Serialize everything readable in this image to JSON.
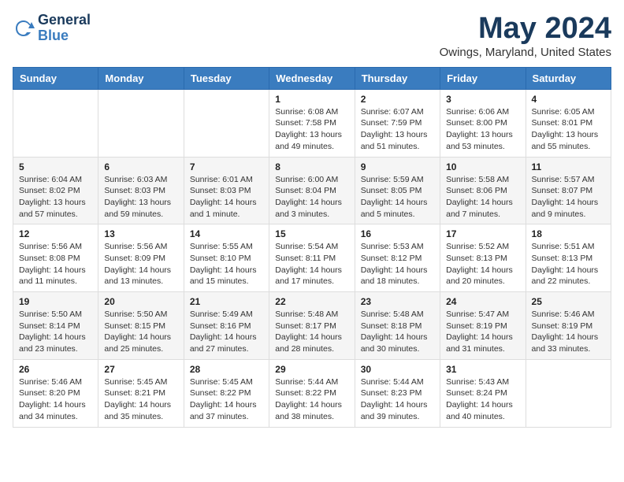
{
  "header": {
    "logo_general": "General",
    "logo_blue": "Blue",
    "month_title": "May 2024",
    "location": "Owings, Maryland, United States"
  },
  "weekdays": [
    "Sunday",
    "Monday",
    "Tuesday",
    "Wednesday",
    "Thursday",
    "Friday",
    "Saturday"
  ],
  "weeks": [
    [
      {
        "day": "",
        "sunrise": "",
        "sunset": "",
        "daylight": ""
      },
      {
        "day": "",
        "sunrise": "",
        "sunset": "",
        "daylight": ""
      },
      {
        "day": "",
        "sunrise": "",
        "sunset": "",
        "daylight": ""
      },
      {
        "day": "1",
        "sunrise": "Sunrise: 6:08 AM",
        "sunset": "Sunset: 7:58 PM",
        "daylight": "Daylight: 13 hours and 49 minutes."
      },
      {
        "day": "2",
        "sunrise": "Sunrise: 6:07 AM",
        "sunset": "Sunset: 7:59 PM",
        "daylight": "Daylight: 13 hours and 51 minutes."
      },
      {
        "day": "3",
        "sunrise": "Sunrise: 6:06 AM",
        "sunset": "Sunset: 8:00 PM",
        "daylight": "Daylight: 13 hours and 53 minutes."
      },
      {
        "day": "4",
        "sunrise": "Sunrise: 6:05 AM",
        "sunset": "Sunset: 8:01 PM",
        "daylight": "Daylight: 13 hours and 55 minutes."
      }
    ],
    [
      {
        "day": "5",
        "sunrise": "Sunrise: 6:04 AM",
        "sunset": "Sunset: 8:02 PM",
        "daylight": "Daylight: 13 hours and 57 minutes."
      },
      {
        "day": "6",
        "sunrise": "Sunrise: 6:03 AM",
        "sunset": "Sunset: 8:03 PM",
        "daylight": "Daylight: 13 hours and 59 minutes."
      },
      {
        "day": "7",
        "sunrise": "Sunrise: 6:01 AM",
        "sunset": "Sunset: 8:03 PM",
        "daylight": "Daylight: 14 hours and 1 minute."
      },
      {
        "day": "8",
        "sunrise": "Sunrise: 6:00 AM",
        "sunset": "Sunset: 8:04 PM",
        "daylight": "Daylight: 14 hours and 3 minutes."
      },
      {
        "day": "9",
        "sunrise": "Sunrise: 5:59 AM",
        "sunset": "Sunset: 8:05 PM",
        "daylight": "Daylight: 14 hours and 5 minutes."
      },
      {
        "day": "10",
        "sunrise": "Sunrise: 5:58 AM",
        "sunset": "Sunset: 8:06 PM",
        "daylight": "Daylight: 14 hours and 7 minutes."
      },
      {
        "day": "11",
        "sunrise": "Sunrise: 5:57 AM",
        "sunset": "Sunset: 8:07 PM",
        "daylight": "Daylight: 14 hours and 9 minutes."
      }
    ],
    [
      {
        "day": "12",
        "sunrise": "Sunrise: 5:56 AM",
        "sunset": "Sunset: 8:08 PM",
        "daylight": "Daylight: 14 hours and 11 minutes."
      },
      {
        "day": "13",
        "sunrise": "Sunrise: 5:56 AM",
        "sunset": "Sunset: 8:09 PM",
        "daylight": "Daylight: 14 hours and 13 minutes."
      },
      {
        "day": "14",
        "sunrise": "Sunrise: 5:55 AM",
        "sunset": "Sunset: 8:10 PM",
        "daylight": "Daylight: 14 hours and 15 minutes."
      },
      {
        "day": "15",
        "sunrise": "Sunrise: 5:54 AM",
        "sunset": "Sunset: 8:11 PM",
        "daylight": "Daylight: 14 hours and 17 minutes."
      },
      {
        "day": "16",
        "sunrise": "Sunrise: 5:53 AM",
        "sunset": "Sunset: 8:12 PM",
        "daylight": "Daylight: 14 hours and 18 minutes."
      },
      {
        "day": "17",
        "sunrise": "Sunrise: 5:52 AM",
        "sunset": "Sunset: 8:13 PM",
        "daylight": "Daylight: 14 hours and 20 minutes."
      },
      {
        "day": "18",
        "sunrise": "Sunrise: 5:51 AM",
        "sunset": "Sunset: 8:13 PM",
        "daylight": "Daylight: 14 hours and 22 minutes."
      }
    ],
    [
      {
        "day": "19",
        "sunrise": "Sunrise: 5:50 AM",
        "sunset": "Sunset: 8:14 PM",
        "daylight": "Daylight: 14 hours and 23 minutes."
      },
      {
        "day": "20",
        "sunrise": "Sunrise: 5:50 AM",
        "sunset": "Sunset: 8:15 PM",
        "daylight": "Daylight: 14 hours and 25 minutes."
      },
      {
        "day": "21",
        "sunrise": "Sunrise: 5:49 AM",
        "sunset": "Sunset: 8:16 PM",
        "daylight": "Daylight: 14 hours and 27 minutes."
      },
      {
        "day": "22",
        "sunrise": "Sunrise: 5:48 AM",
        "sunset": "Sunset: 8:17 PM",
        "daylight": "Daylight: 14 hours and 28 minutes."
      },
      {
        "day": "23",
        "sunrise": "Sunrise: 5:48 AM",
        "sunset": "Sunset: 8:18 PM",
        "daylight": "Daylight: 14 hours and 30 minutes."
      },
      {
        "day": "24",
        "sunrise": "Sunrise: 5:47 AM",
        "sunset": "Sunset: 8:19 PM",
        "daylight": "Daylight: 14 hours and 31 minutes."
      },
      {
        "day": "25",
        "sunrise": "Sunrise: 5:46 AM",
        "sunset": "Sunset: 8:19 PM",
        "daylight": "Daylight: 14 hours and 33 minutes."
      }
    ],
    [
      {
        "day": "26",
        "sunrise": "Sunrise: 5:46 AM",
        "sunset": "Sunset: 8:20 PM",
        "daylight": "Daylight: 14 hours and 34 minutes."
      },
      {
        "day": "27",
        "sunrise": "Sunrise: 5:45 AM",
        "sunset": "Sunset: 8:21 PM",
        "daylight": "Daylight: 14 hours and 35 minutes."
      },
      {
        "day": "28",
        "sunrise": "Sunrise: 5:45 AM",
        "sunset": "Sunset: 8:22 PM",
        "daylight": "Daylight: 14 hours and 37 minutes."
      },
      {
        "day": "29",
        "sunrise": "Sunrise: 5:44 AM",
        "sunset": "Sunset: 8:22 PM",
        "daylight": "Daylight: 14 hours and 38 minutes."
      },
      {
        "day": "30",
        "sunrise": "Sunrise: 5:44 AM",
        "sunset": "Sunset: 8:23 PM",
        "daylight": "Daylight: 14 hours and 39 minutes."
      },
      {
        "day": "31",
        "sunrise": "Sunrise: 5:43 AM",
        "sunset": "Sunset: 8:24 PM",
        "daylight": "Daylight: 14 hours and 40 minutes."
      },
      {
        "day": "",
        "sunrise": "",
        "sunset": "",
        "daylight": ""
      }
    ]
  ]
}
